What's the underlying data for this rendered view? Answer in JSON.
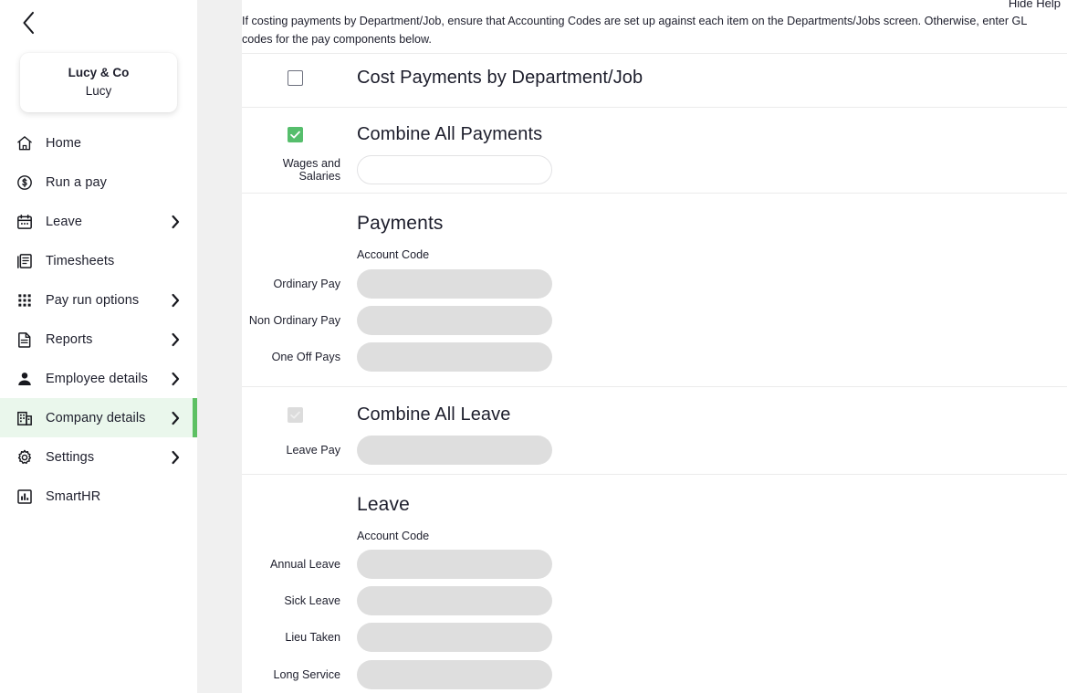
{
  "sidebar": {
    "back_icon": "chevron-left-icon",
    "company": {
      "name": "Lucy & Co",
      "user": "Lucy"
    },
    "items": [
      {
        "label": "Home",
        "icon": "home-icon",
        "has_arrow": false,
        "active": false
      },
      {
        "label": "Run a pay",
        "icon": "dollar-circle-icon",
        "has_arrow": false,
        "active": false
      },
      {
        "label": "Leave",
        "icon": "calendar-icon",
        "has_arrow": true,
        "active": false
      },
      {
        "label": "Timesheets",
        "icon": "document-lines-icon",
        "has_arrow": false,
        "active": false
      },
      {
        "label": "Pay run options",
        "icon": "grid-dots-icon",
        "has_arrow": true,
        "active": false
      },
      {
        "label": "Reports",
        "icon": "file-text-icon",
        "has_arrow": true,
        "active": false
      },
      {
        "label": "Employee details",
        "icon": "person-icon",
        "has_arrow": true,
        "active": false
      },
      {
        "label": "Company details",
        "icon": "building-icon",
        "has_arrow": true,
        "active": true
      },
      {
        "label": "Settings",
        "icon": "gear-icon",
        "has_arrow": true,
        "active": false
      },
      {
        "label": "SmartHR",
        "icon": "bar-chart-icon",
        "has_arrow": false,
        "active": false
      }
    ],
    "accent_color": "#5dc063",
    "active_background": "#eaf7ec"
  },
  "main": {
    "hide_help_label": "Hide Help",
    "help_text": "If costing payments by Department/Job, ensure that Accounting Codes are set up against each item on the Departments/Jobs screen. Otherwise, enter GL codes for the pay components below.",
    "cost_payments": {
      "label": "Cost Payments by Department/Job",
      "checked": false,
      "disabled": false
    },
    "combine_payments": {
      "label": "Combine All Payments",
      "checked": true,
      "disabled": false,
      "field_label": "Wages and Salaries",
      "field_value": "",
      "field_disabled": false
    },
    "payments_section": {
      "title": "Payments",
      "column_header": "Account Code",
      "rows": [
        {
          "label": "Ordinary Pay",
          "value": "",
          "disabled": true
        },
        {
          "label": "Non Ordinary Pay",
          "value": "",
          "disabled": true
        },
        {
          "label": "One Off Pays",
          "value": "",
          "disabled": true
        }
      ]
    },
    "combine_leave": {
      "label": "Combine All Leave",
      "checked": true,
      "disabled": true,
      "field_label": "Leave Pay",
      "field_value": "",
      "field_disabled": true
    },
    "leave_section": {
      "title": "Leave",
      "column_header": "Account Code",
      "rows": [
        {
          "label": "Annual Leave",
          "value": "",
          "disabled": true
        },
        {
          "label": "Sick Leave",
          "value": "",
          "disabled": true
        },
        {
          "label": "Lieu Taken",
          "value": "",
          "disabled": true
        },
        {
          "label": "Long Service",
          "value": "",
          "disabled": true
        }
      ]
    },
    "checkbox_checked_color": "#56be6c",
    "checkbox_disabled_color": "#dcdcdc"
  }
}
